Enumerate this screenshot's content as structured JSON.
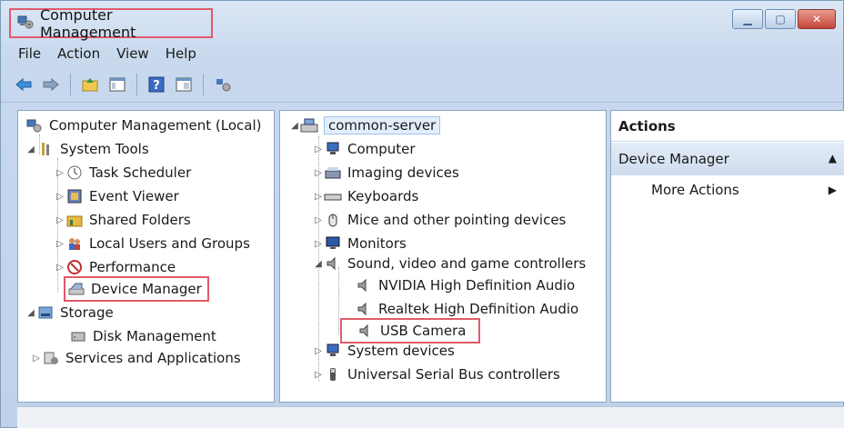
{
  "window": {
    "title": "Computer Management",
    "controls": [
      "minimize",
      "maximize",
      "close"
    ]
  },
  "menu": [
    "File",
    "Action",
    "View",
    "Help"
  ],
  "toolbar": {
    "icons": [
      "back-arrow-icon",
      "forward-arrow-icon",
      "up-folder-icon",
      "show-hide-tree-icon",
      "help-icon",
      "properties-icon",
      "connect-icon"
    ]
  },
  "left_tree": [
    {
      "label": "Computer Management (Local)",
      "level": 0,
      "expander": "",
      "icon": "computer-management-icon"
    },
    {
      "label": "System Tools",
      "level": 1,
      "expander": "expanded",
      "icon": "system-tools-icon"
    },
    {
      "label": "Task Scheduler",
      "level": 2,
      "expander": "collapsed",
      "icon": "clock-icon"
    },
    {
      "label": "Event Viewer",
      "level": 2,
      "expander": "collapsed",
      "icon": "event-viewer-icon"
    },
    {
      "label": "Shared Folders",
      "level": 2,
      "expander": "collapsed",
      "icon": "shared-folder-icon"
    },
    {
      "label": "Local Users and Groups",
      "level": 2,
      "expander": "collapsed",
      "icon": "users-icon"
    },
    {
      "label": "Performance",
      "level": 2,
      "expander": "collapsed",
      "icon": "performance-icon"
    },
    {
      "label": "Device Manager",
      "level": 2,
      "expander": "",
      "icon": "device-manager-icon",
      "highlight": true
    },
    {
      "label": "Storage",
      "level": 1,
      "expander": "expanded",
      "icon": "storage-icon"
    },
    {
      "label": "Disk Management",
      "level": 2,
      "expander": "",
      "icon": "disk-icon"
    },
    {
      "label": "Services and Applications",
      "level": 1,
      "expander": "collapsed",
      "icon": "services-icon"
    }
  ],
  "device_tree": [
    {
      "label": "common-server",
      "level": 0,
      "expander": "expanded",
      "icon": "server-icon",
      "selected": true
    },
    {
      "label": "Computer",
      "level": 1,
      "expander": "collapsed",
      "icon": "computer-icon"
    },
    {
      "label": "Imaging devices",
      "level": 1,
      "expander": "collapsed",
      "icon": "scanner-icon"
    },
    {
      "label": "Keyboards",
      "level": 1,
      "expander": "collapsed",
      "icon": "keyboard-icon"
    },
    {
      "label": "Mice and other pointing devices",
      "level": 1,
      "expander": "collapsed",
      "icon": "mouse-icon"
    },
    {
      "label": "Monitors",
      "level": 1,
      "expander": "collapsed",
      "icon": "monitor-icon"
    },
    {
      "label": "Sound, video and game controllers",
      "level": 1,
      "expander": "expanded",
      "icon": "speaker-icon"
    },
    {
      "label": "NVIDIA High Definition Audio",
      "level": 2,
      "expander": "",
      "icon": "speaker-icon"
    },
    {
      "label": "Realtek High Definition Audio",
      "level": 2,
      "expander": "",
      "icon": "speaker-icon"
    },
    {
      "label": "USB Camera",
      "level": 2,
      "expander": "",
      "icon": "speaker-icon",
      "highlight": true
    },
    {
      "label": "System devices",
      "level": 1,
      "expander": "collapsed",
      "icon": "system-devices-icon"
    },
    {
      "label": "Universal Serial Bus controllers",
      "level": 1,
      "expander": "collapsed",
      "icon": "usb-icon"
    }
  ],
  "actions": {
    "header": "Actions",
    "section": "Device Manager",
    "item": "More Actions"
  },
  "colors": {
    "highlight_border": "#e05a6a",
    "window_chrome": "#c8d9ee"
  }
}
